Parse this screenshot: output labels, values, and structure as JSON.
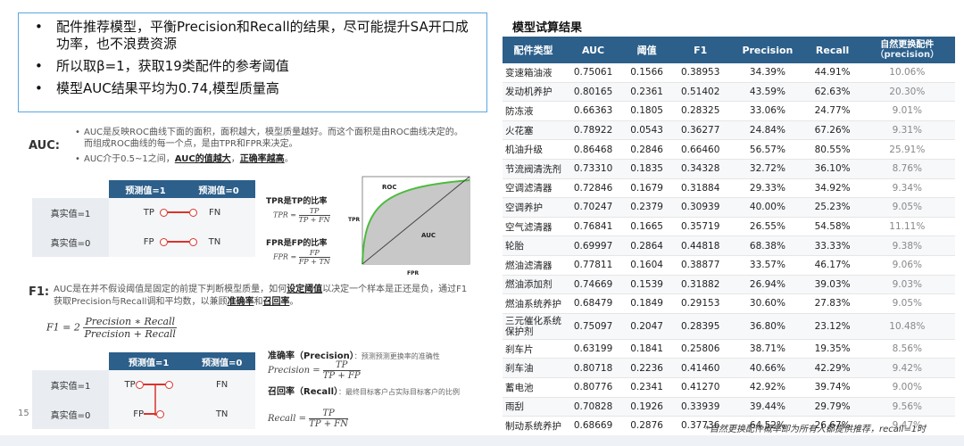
{
  "summary": {
    "bullets": [
      "配件推荐模型，平衡Precision和Recall的结果，尽可能提升SA开口成功率，也不浪费资源",
      "所以取β=1，获取19类配件的参考阈值",
      "模型AUC结果平均为0.74,模型质量高"
    ]
  },
  "auc": {
    "label": "AUC:",
    "note1": "AUC是反映ROC曲线下面的面积，面积越大，模型质量越好。而这个面积是由ROC曲线决定的。而组成ROC曲线的每一个点，是由TPR和FPR来决定。",
    "note2_pre": "AUC介于0.5~1之间，",
    "note2_u1": "AUC的值越大",
    "note2_mid": "，",
    "note2_u2": "正确率越高",
    "note2_post": "。",
    "matrix": {
      "col1": "预测值=1",
      "col2": "预测值=0",
      "row1": "真实值=1",
      "row2": "真实值=0",
      "tp": "TP",
      "fn": "FN",
      "fp": "FP",
      "tn": "TN"
    },
    "tpr_title": "TPR是TP的比率",
    "tpr_lhs": "TPR = ",
    "tpr_num": "TP",
    "tpr_den": "TP + FN",
    "fpr_title": "FPR是FP的比率",
    "fpr_lhs": "FPR = ",
    "fpr_num": "FP",
    "fpr_den": "FP + TN",
    "roc": {
      "roc_label": "ROC",
      "auc_label": "AUC",
      "y_label": "TPR",
      "x_label": "FPR"
    }
  },
  "f1": {
    "label": "F1:",
    "text_pre": "AUC是在并不假设阈值是固定的前提下判断模型质量，如何",
    "text_u1": "设定阈值",
    "text_mid1": "以决定一个样本是正还是负，通过F1获取Precision与Recall调和平均数，以兼顾",
    "text_u2": "准确率",
    "text_mid2": "和",
    "text_u3": "召回率",
    "text_post": "。",
    "formula_lhs": "F1 = 2",
    "formula_num": "Precision ∗ Recall",
    "formula_den": "Precision + Recall",
    "matrix": {
      "col1": "预测值=1",
      "col2": "预测值=0",
      "row1": "真实值=1",
      "row2": "真实值=0",
      "tp": "TP",
      "fn": "FN",
      "fp": "FP",
      "tn": "TN"
    },
    "precision_title": "准确率（Precision）",
    "precision_sub": "：预测预测更换率的准确性",
    "precision_lhs": "Precision = ",
    "precision_num": "TP",
    "precision_den": "TP + FP",
    "recall_title": "召回率（Recall）",
    "recall_sub": "：最终目标客户占实际目标客户的比例",
    "recall_lhs": "Recall = ",
    "recall_num": "TP",
    "recall_den": "TP + FN"
  },
  "results": {
    "title": "模型试算结果",
    "headers": [
      "配件类型",
      "AUC",
      "阈值",
      "F1",
      "Precision",
      "Recall",
      "自然更换配件",
      "（precision）"
    ],
    "rows": [
      [
        "变速箱油液",
        "0.75061",
        "0.1566",
        "0.38953",
        "34.39%",
        "44.91%",
        "10.06%"
      ],
      [
        "发动机养护",
        "0.80165",
        "0.2361",
        "0.51402",
        "43.59%",
        "62.63%",
        "20.30%"
      ],
      [
        "防冻液",
        "0.66363",
        "0.1805",
        "0.28325",
        "33.06%",
        "24.77%",
        "9.01%"
      ],
      [
        "火花塞",
        "0.78922",
        "0.0543",
        "0.36277",
        "24.84%",
        "67.26%",
        "9.31%"
      ],
      [
        "机油升级",
        "0.86468",
        "0.2846",
        "0.66460",
        "56.57%",
        "80.55%",
        "25.91%"
      ],
      [
        "节流阀清洗剂",
        "0.73310",
        "0.1835",
        "0.34328",
        "32.72%",
        "36.10%",
        "8.76%"
      ],
      [
        "空调滤清器",
        "0.72846",
        "0.1679",
        "0.31884",
        "29.33%",
        "34.92%",
        "9.34%"
      ],
      [
        "空调养护",
        "0.70247",
        "0.2379",
        "0.30939",
        "40.00%",
        "25.23%",
        "9.05%"
      ],
      [
        "空气滤清器",
        "0.76841",
        "0.1665",
        "0.35719",
        "26.55%",
        "54.58%",
        "11.11%"
      ],
      [
        "轮胎",
        "0.69997",
        "0.2864",
        "0.44818",
        "68.38%",
        "33.33%",
        "9.38%"
      ],
      [
        "燃油滤清器",
        "0.77811",
        "0.1604",
        "0.38877",
        "33.57%",
        "46.17%",
        "9.06%"
      ],
      [
        "燃油添加剂",
        "0.74669",
        "0.1539",
        "0.31882",
        "26.94%",
        "39.03%",
        "9.03%"
      ],
      [
        "燃油系统养护",
        "0.68479",
        "0.1849",
        "0.29153",
        "30.60%",
        "27.83%",
        "9.05%"
      ],
      [
        "三元催化系统保护剂",
        "0.75097",
        "0.2047",
        "0.28395",
        "36.80%",
        "23.12%",
        "10.48%"
      ],
      [
        "刹车片",
        "0.63199",
        "0.1841",
        "0.25806",
        "38.71%",
        "19.35%",
        "8.56%"
      ],
      [
        "刹车油",
        "0.80718",
        "0.2236",
        "0.41460",
        "40.66%",
        "42.29%",
        "9.42%"
      ],
      [
        "蓄电池",
        "0.80776",
        "0.2341",
        "0.41270",
        "42.92%",
        "39.74%",
        "9.00%"
      ],
      [
        "雨刮",
        "0.70828",
        "0.1926",
        "0.33939",
        "39.44%",
        "29.79%",
        "9.56%"
      ],
      [
        "制动系统养护",
        "0.68669",
        "0.2876",
        "0.37736",
        "64.52%",
        "26.67%",
        "9.47%"
      ]
    ],
    "footnote": "*自然更换配件概率即为所有人都提供推荐，recall=1时"
  },
  "page_number": "15",
  "colors": {
    "header_blue": "#2c5f8a",
    "box_border": "#5aa7e0",
    "accent_red": "#d9342b",
    "roc_green": "#4cbb3c"
  }
}
